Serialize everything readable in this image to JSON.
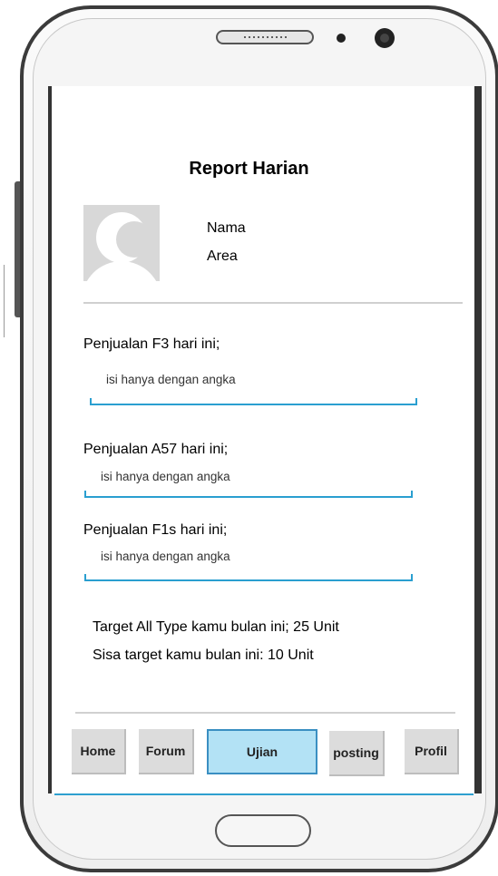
{
  "screen": {
    "title": "Report Harian",
    "profile": {
      "name": "Nama",
      "area": "Area"
    }
  },
  "form": {
    "fields": [
      {
        "label": "Penjualan F3 hari ini;",
        "placeholder": "isi hanya dengan angka"
      },
      {
        "label": "Penjualan A57 hari ini;",
        "placeholder": "isi hanya dengan angka"
      },
      {
        "label": "Penjualan F1s hari ini;",
        "placeholder": "isi hanya dengan angka"
      }
    ]
  },
  "info": {
    "target": "Target All Type kamu bulan ini; 25 Unit",
    "remaining": "Sisa target kamu bulan ini: 10 Unit"
  },
  "nav": {
    "items": [
      {
        "label": "Home",
        "active": false
      },
      {
        "label": "Forum",
        "active": false
      },
      {
        "label": "Ujian",
        "active": true
      },
      {
        "label": "posting",
        "active": false
      },
      {
        "label": "Profil",
        "active": false
      }
    ]
  },
  "colors": {
    "accent": "#2a9fd0",
    "active_tab": "#b3e2f5"
  }
}
